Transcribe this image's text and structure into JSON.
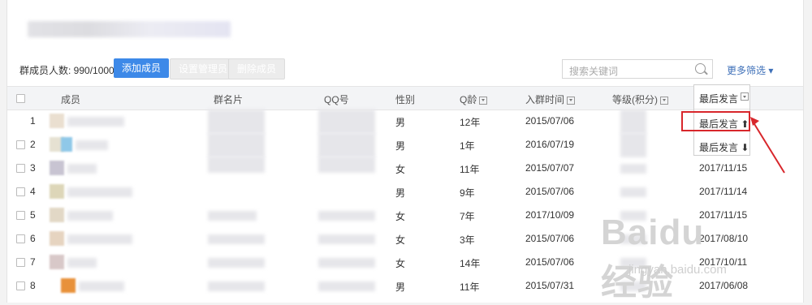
{
  "toolbar": {
    "member_count": "群成员人数: 990/1000",
    "add_member": "添加成员",
    "set_admin": "设置管理员",
    "delete_member": "删除成员",
    "search_placeholder": "搜索关键词",
    "more_filter": "更多筛选 ▾"
  },
  "table": {
    "headers": {
      "member": "成员",
      "group_card": "群名片",
      "qq": "QQ号",
      "gender": "性别",
      "q_age": "Q龄",
      "join_time": "入群时间",
      "level": "等级(积分)",
      "last_speak": "最后发言"
    },
    "rows": [
      {
        "index": "1",
        "gender": "男",
        "q_age": "12年",
        "join": "2015/07/06",
        "last": ""
      },
      {
        "index": "2",
        "gender": "男",
        "q_age": "1年",
        "join": "2016/07/19",
        "last": ""
      },
      {
        "index": "3",
        "gender": "女",
        "q_age": "11年",
        "join": "2015/07/07",
        "last": "2017/11/15"
      },
      {
        "index": "4",
        "gender": "男",
        "q_age": "9年",
        "join": "2015/07/06",
        "last": "2017/11/14"
      },
      {
        "index": "5",
        "gender": "女",
        "q_age": "7年",
        "join": "2017/10/09",
        "last": "2017/11/15"
      },
      {
        "index": "6",
        "gender": "女",
        "q_age": "3年",
        "join": "2015/07/06",
        "last": "2017/08/10"
      },
      {
        "index": "7",
        "gender": "女",
        "q_age": "14年",
        "join": "2015/07/06",
        "last": "2017/10/11"
      },
      {
        "index": "8",
        "gender": "男",
        "q_age": "11年",
        "join": "2015/07/31",
        "last": "2017/06/08"
      }
    ]
  },
  "dropdown": {
    "header": "最后发言",
    "asc": "最后发言 ⬆",
    "desc": "最后发言 ⬇"
  },
  "watermark": {
    "brand": "Baidu经验",
    "url": "jingyan.baidu.com"
  },
  "colors": {
    "primary": "#3d89e8",
    "highlight": "#d8262b",
    "link": "#3d6fb8"
  }
}
